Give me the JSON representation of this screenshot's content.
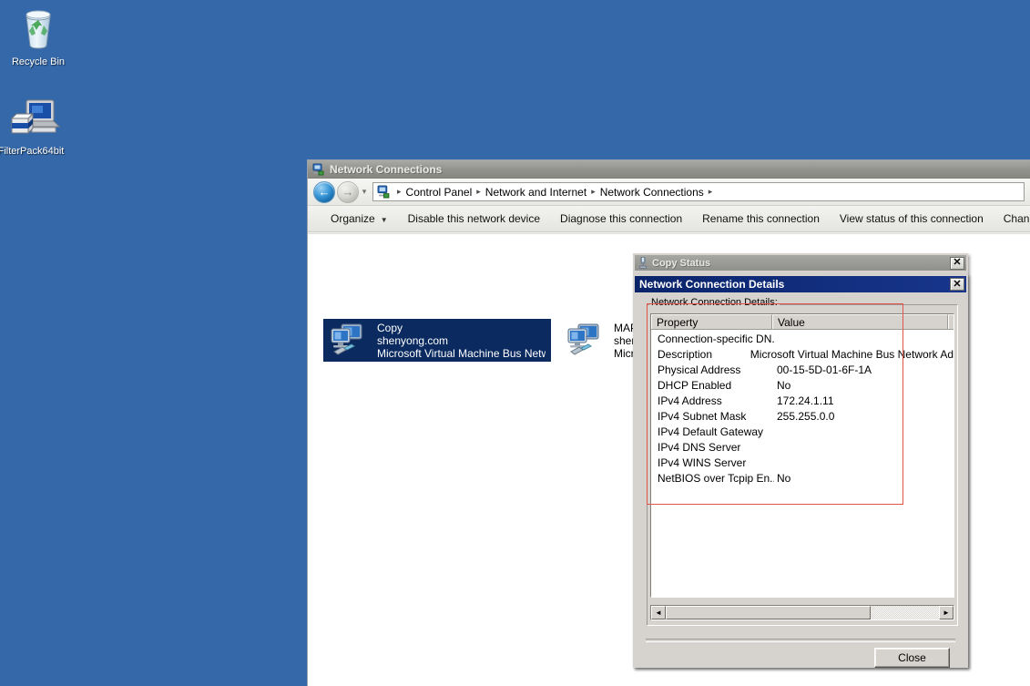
{
  "desktop": {
    "background_color": "#3568a9",
    "icons": [
      {
        "name": "recycle-bin",
        "label": "Recycle Bin"
      },
      {
        "name": "filterpack",
        "label": "FilterPack64bit"
      }
    ]
  },
  "explorer": {
    "title": "Network Connections",
    "title_icon": "network-connections-icon",
    "nav": {
      "back_icon": "back-arrow-icon",
      "forward_icon": "forward-arrow-icon",
      "recent_icon": "chevron-down-icon",
      "address_icon": "network-connections-icon",
      "breadcrumb": [
        "Control Panel",
        "Network and Internet",
        "Network Connections"
      ],
      "separator": "▸"
    },
    "toolbar": {
      "organize": "Organize",
      "organize_caret": "▼",
      "items": [
        "Disable this network device",
        "Diagnose this connection",
        "Rename this connection",
        "View status of this connection",
        "Change settings of this co"
      ]
    },
    "connections": [
      {
        "name": "connection-tile-copy",
        "selected": true,
        "lines": [
          "Copy",
          "shenyong.com",
          "Microsoft Virtual Machine Bus Networ..."
        ]
      },
      {
        "name": "connection-tile-mapi",
        "selected": false,
        "lines": [
          "MAPI",
          "sheny",
          "Micros"
        ]
      }
    ]
  },
  "copy_status": {
    "title": "Copy Status",
    "title_icon": "network-status-icon",
    "close_label": "✕",
    "active": false
  },
  "network_connection_details": {
    "title": "Network Connection Details",
    "close_label": "✕",
    "active": true,
    "accent_color": "#0a246a",
    "group_label": "Network Connection Details:",
    "columns": [
      "Property",
      "Value"
    ],
    "rows": [
      {
        "property": "Connection-specific DN...",
        "value": ""
      },
      {
        "property": "Description",
        "value": "Microsoft Virtual Machine Bus Network Ad"
      },
      {
        "property": "Physical Address",
        "value": "00-15-5D-01-6F-1A"
      },
      {
        "property": "DHCP Enabled",
        "value": "No"
      },
      {
        "property": "IPv4 Address",
        "value": "172.24.1.11"
      },
      {
        "property": "IPv4 Subnet Mask",
        "value": "255.255.0.0"
      },
      {
        "property": "IPv4 Default Gateway",
        "value": ""
      },
      {
        "property": "IPv4 DNS Server",
        "value": ""
      },
      {
        "property": "IPv4 WINS Server",
        "value": ""
      },
      {
        "property": "NetBIOS over Tcpip En...",
        "value": "No"
      }
    ],
    "scrollbar": {
      "left_arrow": "◄",
      "right_arrow": "►",
      "thumb_percent": 75
    },
    "close_button": "Close",
    "annotation_color": "#e0524a"
  }
}
